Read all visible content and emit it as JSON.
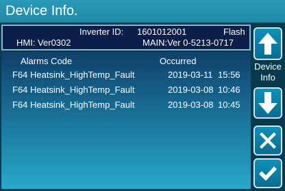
{
  "title": "Device Info.",
  "device": {
    "inverter_label": "Inverter ID:",
    "inverter_id": "1601012001",
    "flash": "Flash",
    "hmi": "HMI: Ver0302",
    "main": "MAIN:Ver 0-5213-0717"
  },
  "alarms": {
    "headers": {
      "code": "Alarms Code",
      "occurred": "Occurred"
    },
    "rows": [
      {
        "code": "F64 Heatsink_HighTemp_Fault",
        "date": "2019-03-11",
        "time": "15:56"
      },
      {
        "code": "F64 Heatsink_HighTemp_Fault",
        "date": "2019-03-08",
        "time": "10:46"
      },
      {
        "code": "F64 Heatsink_HighTemp_Fault",
        "date": "2019-03-08",
        "time": "10:45"
      }
    ]
  },
  "side": {
    "device_label_1": "Device",
    "device_label_2": "Info",
    "up_icon": "arrow-up-icon",
    "down_icon": "arrow-down-icon",
    "cancel_icon": "close-icon",
    "confirm_icon": "check-icon"
  },
  "colors": {
    "title_bar": "#1f8aa8",
    "header_bg": "#0c1e4a",
    "button": "#0e8fb8"
  }
}
